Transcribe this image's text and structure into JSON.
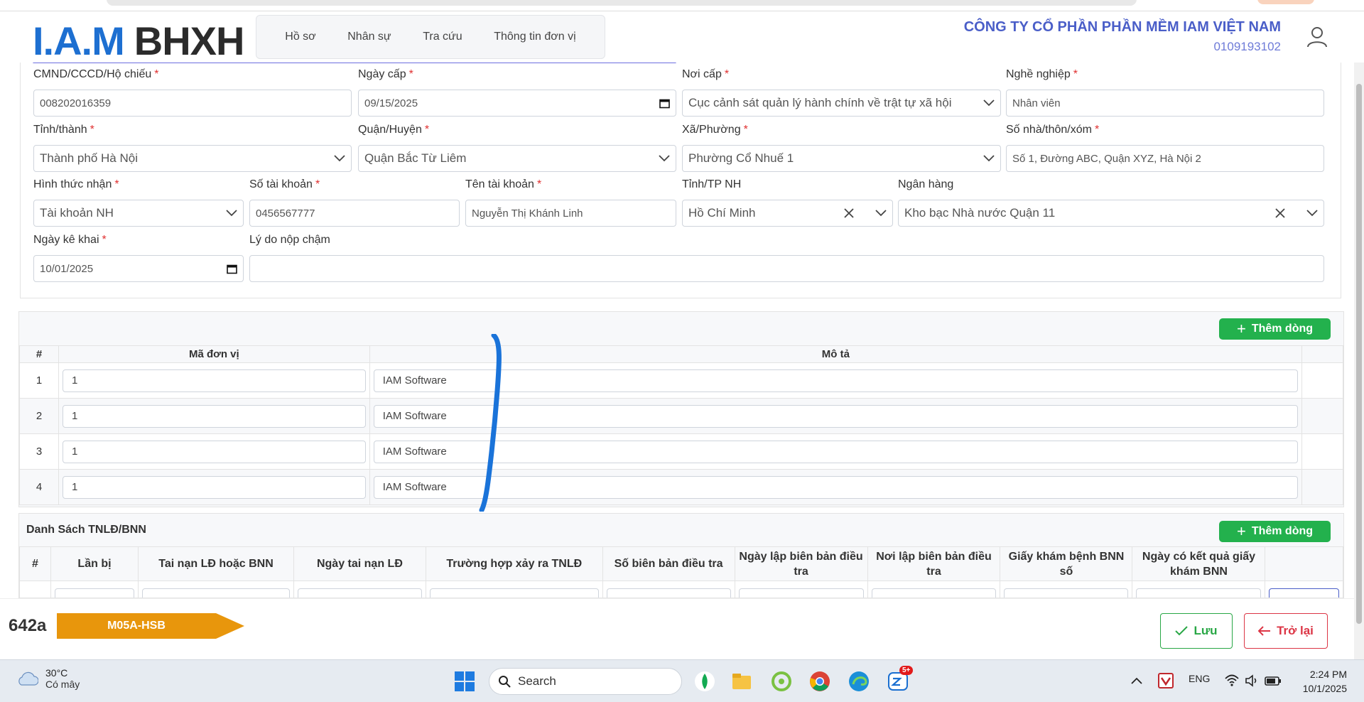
{
  "header": {
    "logo_iam": "I.A.M",
    "logo_bhxh": "BHXH",
    "nav": [
      "Hồ sơ",
      "Nhân sự",
      "Tra cứu",
      "Thông tin đơn vị"
    ],
    "company_name": "CÔNG TY CỔ PHẦN PHẦN MỀM IAM VIỆT NAM",
    "tax_code": "0109193102"
  },
  "form": {
    "cmnd": {
      "label": "CMND/CCCD/Hộ chiếu",
      "value": "008202016359"
    },
    "ngay_cap": {
      "label": "Ngày cấp",
      "value": "09/15/2025"
    },
    "noi_cap": {
      "label": "Nơi cấp",
      "value": "Cục cảnh sát quản lý hành chính về trật tự xã hội"
    },
    "nghe_nghiep": {
      "label": "Nghề nghiệp",
      "value": "Nhân viên"
    },
    "tinh_thanh": {
      "label": "Tỉnh/thành",
      "value": "Thành phố Hà Nội"
    },
    "quan_huyen": {
      "label": "Quận/Huyện",
      "value": "Quận Bắc Từ Liêm"
    },
    "xa_phuong": {
      "label": "Xã/Phường",
      "value": "Phường Cổ Nhuế 1"
    },
    "so_nha": {
      "label": "Số nhà/thôn/xóm",
      "value": "Số 1, Đường ABC, Quận XYZ, Hà Nội 2"
    },
    "hinh_thuc_nhan": {
      "label": "Hình thức nhận",
      "value": "Tài khoản NH"
    },
    "so_tai_khoan": {
      "label": "Số tài khoản",
      "value": "0456567777"
    },
    "ten_tai_khoan": {
      "label": "Tên tài khoản",
      "value": "Nguyễn Thị Khánh Linh"
    },
    "tinh_tp_nh": {
      "label": "Tỉnh/TP NH",
      "value": "Hồ Chí Minh"
    },
    "ngan_hang": {
      "label": "Ngân hàng",
      "value": "Kho bạc Nhà nước Quận 11"
    },
    "ngay_ke_khai": {
      "label": "Ngày kê khai",
      "value": "10/01/2025"
    },
    "ly_do": {
      "label": "Lý do nộp chậm",
      "value": ""
    }
  },
  "units_table": {
    "add_label": "Thêm dòng",
    "headers": [
      "#",
      "Mã đơn vị",
      "Mô tả"
    ],
    "rows": [
      {
        "n": "1",
        "ma": "1",
        "mota": "IAM Software"
      },
      {
        "n": "2",
        "ma": "1",
        "mota": "IAM Software"
      },
      {
        "n": "3",
        "ma": "1",
        "mota": "IAM Software"
      },
      {
        "n": "4",
        "ma": "1",
        "mota": "IAM Software"
      }
    ]
  },
  "tnld": {
    "title": "Danh Sách TNLĐ/BNN",
    "add_label": "Thêm dòng",
    "headers": [
      "#",
      "Lần bị",
      "Tai nạn LĐ hoặc BNN",
      "Ngày tai nạn LĐ",
      "Trường hợp xảy ra TNLĐ",
      "Số biên bản điều tra",
      "Ngày lập biên bản điều tra",
      "Nơi lập biên bản điều tra",
      "Giấy khám bệnh BNN số",
      "Ngày có kết quả giấy khám BNN"
    ]
  },
  "footer": {
    "code": "642a",
    "form_tag": "M05A-HSB",
    "save": "Lưu",
    "back": "Trở lại",
    "tag_color": "#e8960c"
  },
  "taskbar": {
    "temp": "30°C",
    "weather": "Có mây",
    "search": "Search",
    "lang": "ENG",
    "time": "2:24 PM",
    "date": "10/1/2025",
    "badge": "5+"
  }
}
